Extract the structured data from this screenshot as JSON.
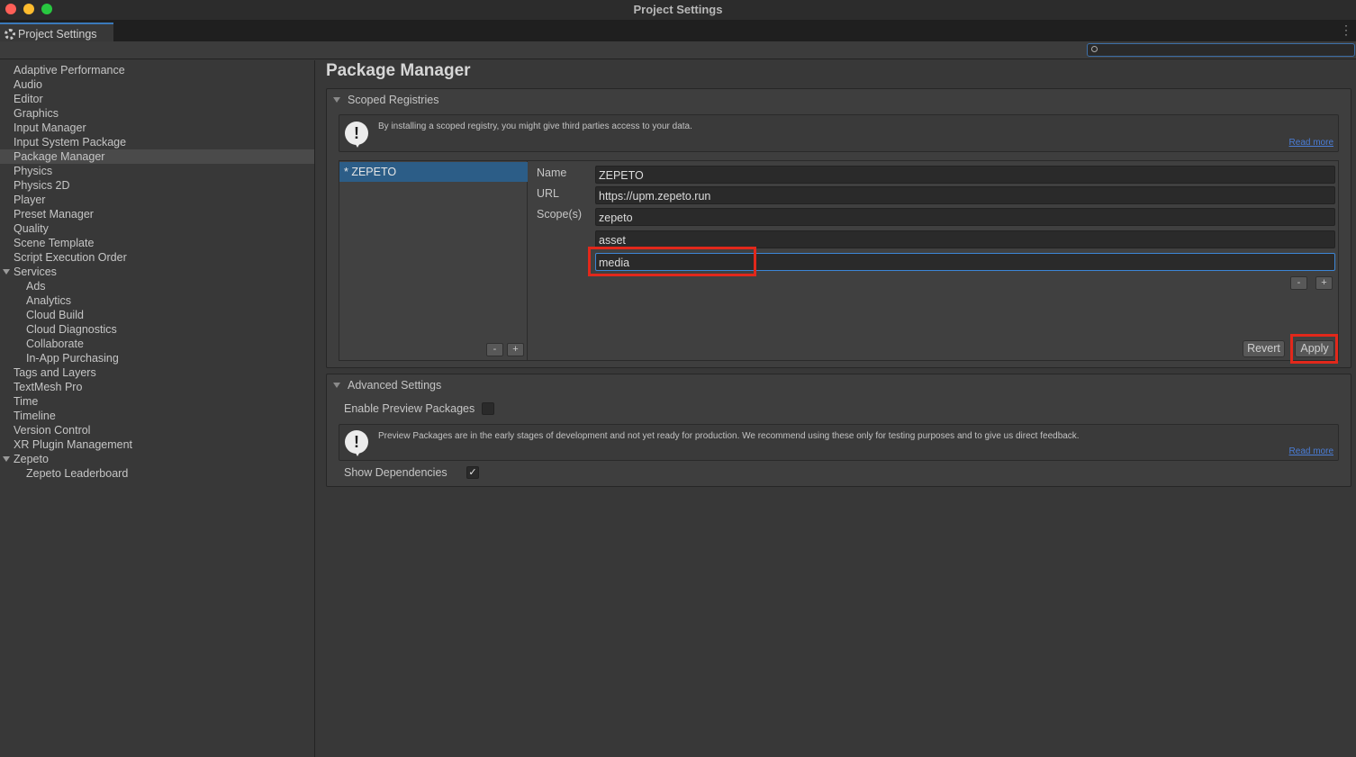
{
  "window": {
    "title": "Project Settings"
  },
  "tab": {
    "label": "Project Settings"
  },
  "search": {
    "placeholder": ""
  },
  "sidebar": {
    "items": [
      {
        "label": "Adaptive Performance"
      },
      {
        "label": "Audio"
      },
      {
        "label": "Editor"
      },
      {
        "label": "Graphics"
      },
      {
        "label": "Input Manager"
      },
      {
        "label": "Input System Package"
      },
      {
        "label": "Package Manager"
      },
      {
        "label": "Physics"
      },
      {
        "label": "Physics 2D"
      },
      {
        "label": "Player"
      },
      {
        "label": "Preset Manager"
      },
      {
        "label": "Quality"
      },
      {
        "label": "Scene Template"
      },
      {
        "label": "Script Execution Order"
      },
      {
        "label": "Services"
      },
      {
        "label": "Ads"
      },
      {
        "label": "Analytics"
      },
      {
        "label": "Cloud Build"
      },
      {
        "label": "Cloud Diagnostics"
      },
      {
        "label": "Collaborate"
      },
      {
        "label": "In-App Purchasing"
      },
      {
        "label": "Tags and Layers"
      },
      {
        "label": "TextMesh Pro"
      },
      {
        "label": "Time"
      },
      {
        "label": "Timeline"
      },
      {
        "label": "Version Control"
      },
      {
        "label": "XR Plugin Management"
      },
      {
        "label": "Zepeto"
      },
      {
        "label": "Zepeto Leaderboard"
      }
    ]
  },
  "main": {
    "title": "Package Manager",
    "scoped": {
      "header": "Scoped Registries",
      "help_text": "By installing a scoped registry, you might give third parties access to your data.",
      "read_more": "Read more",
      "registry_item": "* ZEPETO",
      "name_label": "Name",
      "url_label": "URL",
      "scopes_label": "Scope(s)",
      "name_value": "ZEPETO",
      "url_value": "https://upm.zepeto.run",
      "scopes": [
        "zepeto",
        "asset",
        "media"
      ],
      "minus": "-",
      "plus": "+",
      "revert": "Revert",
      "apply": "Apply"
    },
    "advanced": {
      "header": "Advanced Settings",
      "enable_preview_label": "Enable Preview Packages",
      "help_text": "Preview Packages are in the early stages of development and not yet ready for production. We recommend using these only for testing purposes and to give us direct feedback.",
      "read_more": "Read more",
      "show_deps_label": "Show Dependencies",
      "check_mark": "✓"
    }
  },
  "warning_glyph": "!",
  "colors": {
    "selection": "#2c5d87",
    "highlight": "#e2281b",
    "focus": "#3d86d6"
  }
}
